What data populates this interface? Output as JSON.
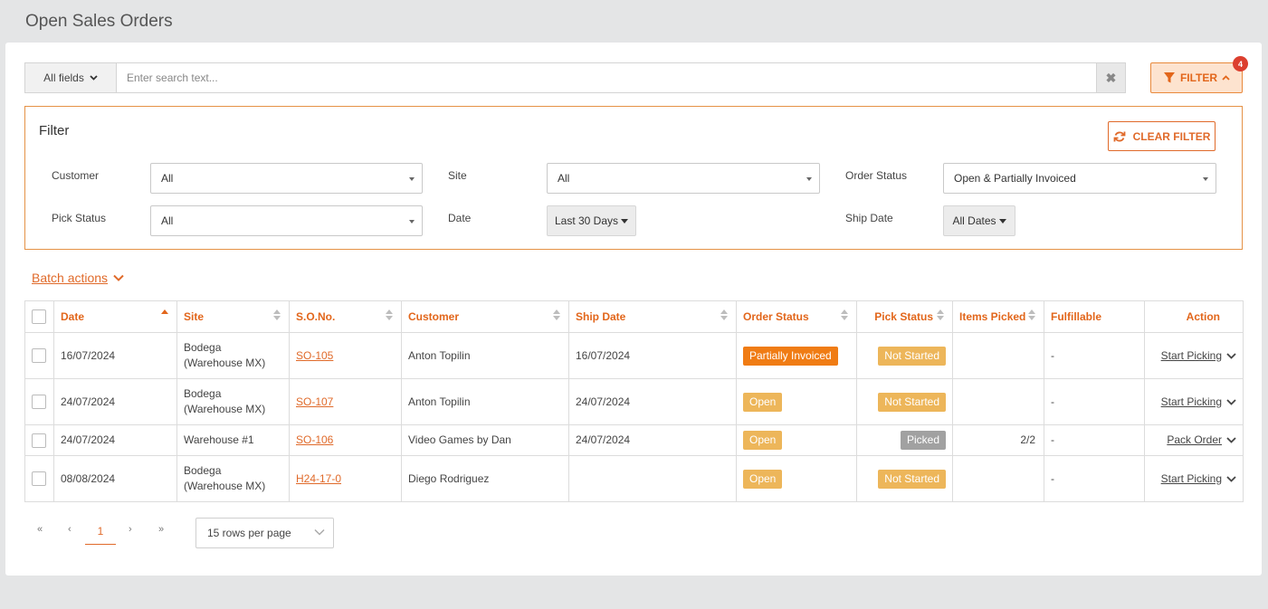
{
  "page": {
    "title": "Open Sales Orders"
  },
  "search": {
    "field_select_label": "All fields",
    "placeholder": "Enter search text...",
    "clear_glyph": "✖"
  },
  "filter_button": {
    "label": "FILTER",
    "badge_count": "4"
  },
  "filter_panel": {
    "title": "Filter",
    "clear_label": "CLEAR FILTER",
    "customer": {
      "label": "Customer",
      "value": "All"
    },
    "site": {
      "label": "Site",
      "value": "All"
    },
    "order_status": {
      "label": "Order Status",
      "value": "Open & Partially Invoiced"
    },
    "pick_status": {
      "label": "Pick Status",
      "value": "All"
    },
    "date": {
      "label": "Date",
      "value": "Last 30 Days"
    },
    "ship_date": {
      "label": "Ship Date",
      "value": "All Dates"
    }
  },
  "batch_actions": {
    "label": "Batch actions"
  },
  "table": {
    "columns": {
      "date": "Date",
      "site": "Site",
      "so_no": "S.O.No.",
      "customer": "Customer",
      "ship_date": "Ship Date",
      "order_status": "Order Status",
      "pick_status": "Pick Status",
      "items_picked": "Items Picked",
      "fulfillable": "Fulfillable",
      "action": "Action"
    },
    "rows": [
      {
        "date": "16/07/2024",
        "site": "Bodega (Warehouse MX)",
        "so_no": "SO-105",
        "customer": "Anton Topilin",
        "ship_date": "16/07/2024",
        "order_status": "Partially Invoiced",
        "pick_status": "Not Started",
        "items_picked": "",
        "fulfillable": "-",
        "action": "Start Picking"
      },
      {
        "date": "24/07/2024",
        "site": "Bodega (Warehouse MX)",
        "so_no": "SO-107",
        "customer": "Anton Topilin",
        "ship_date": "24/07/2024",
        "order_status": "Open",
        "pick_status": "Not Started",
        "items_picked": "",
        "fulfillable": "-",
        "action": "Start Picking"
      },
      {
        "date": "24/07/2024",
        "site": "Warehouse #1",
        "so_no": "SO-106",
        "customer": "Video Games by Dan",
        "ship_date": "24/07/2024",
        "order_status": "Open",
        "pick_status": "Picked",
        "items_picked": "2/2",
        "fulfillable": "-",
        "action": "Pack Order"
      },
      {
        "date": "08/08/2024",
        "site": "Bodega (Warehouse MX)",
        "so_no": "H24-17-0",
        "customer": "Diego Rodriguez",
        "ship_date": "",
        "order_status": "Open",
        "pick_status": "Not Started",
        "items_picked": "",
        "fulfillable": "-",
        "action": "Start Picking"
      }
    ]
  },
  "pagination": {
    "first": "«",
    "prev": "‹",
    "current": "1",
    "next": "›",
    "last": "»",
    "rows_per_page": "15 rows per page"
  },
  "colors": {
    "accent": "#e2661b",
    "partially_invoiced": "#f07c14",
    "open": "#edb65a",
    "picked": "#a1a1a1"
  }
}
